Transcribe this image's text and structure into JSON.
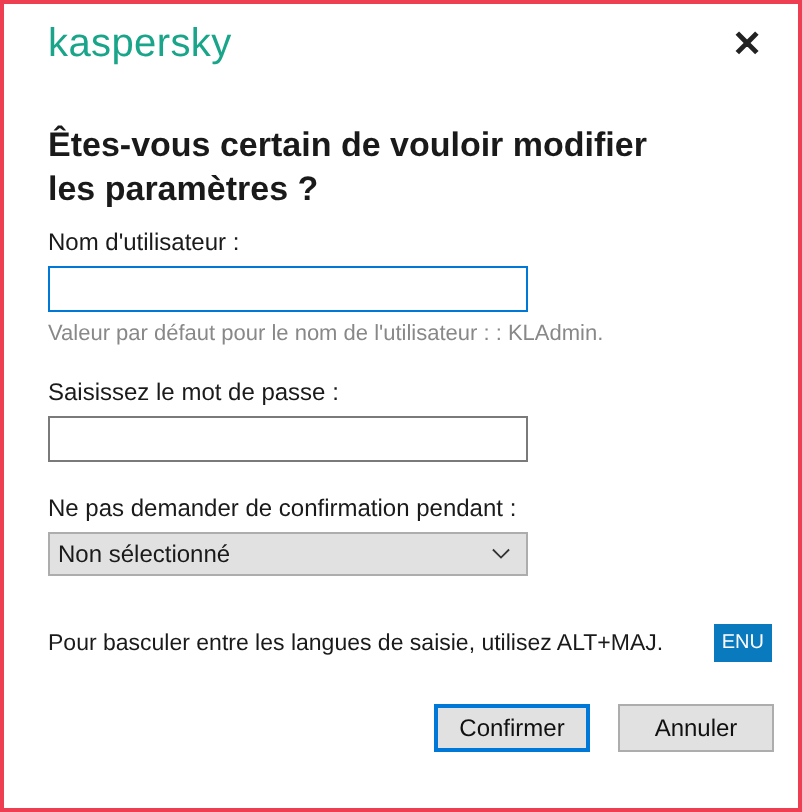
{
  "window": {
    "logo": "kaspersky",
    "close": "✕"
  },
  "title": "Êtes-vous certain de vouloir modifier les paramètres ?",
  "fields": [
    {
      "kind": "text",
      "label": "Nom d'utilisateur :",
      "focused": true,
      "hint": "Valeur par défaut pour le nom de l'utilisateur : : KLAdmin."
    },
    {
      "kind": "password",
      "label": "Saisissez le mot de passe :",
      "focused": false
    },
    {
      "kind": "select",
      "label": "Ne pas demander de confirmation pendant :",
      "value": "Non sélectionné",
      "focused": false
    }
  ],
  "keyboard_note": {
    "text": "Pour basculer entre les langues de saisie, utilisez ALT+MAJ.",
    "language": "ENU"
  },
  "buttons": [
    {
      "label": "Confirmer",
      "default": true
    },
    {
      "label": "Annuler",
      "default": false
    }
  ]
}
